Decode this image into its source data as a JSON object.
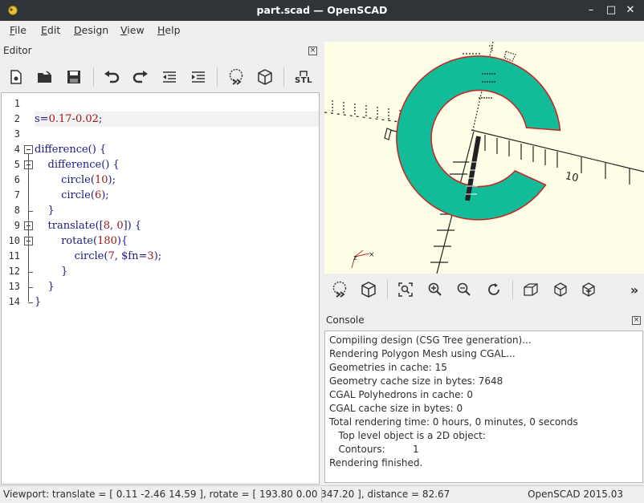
{
  "window": {
    "title": "part.scad — OpenSCAD",
    "minimize": "–",
    "maximize": "□",
    "close": "✕"
  },
  "menubar": {
    "items": [
      {
        "label": "File"
      },
      {
        "label": "Edit"
      },
      {
        "label": "Design"
      },
      {
        "label": "View"
      },
      {
        "label": "Help"
      }
    ]
  },
  "editor": {
    "title": "Editor",
    "toolbar": [
      {
        "icon": "new-file-icon"
      },
      {
        "icon": "open-file-icon"
      },
      {
        "icon": "save-icon"
      },
      {
        "icon": "undo-icon"
      },
      {
        "icon": "redo-icon"
      },
      {
        "icon": "unindent-icon"
      },
      {
        "icon": "indent-icon"
      },
      {
        "icon": "preview-icon"
      },
      {
        "icon": "render-icon"
      },
      {
        "icon": "export-stl-icon",
        "label": "STL"
      }
    ],
    "lines": [
      {
        "num": "1",
        "text": ""
      },
      {
        "num": "2",
        "text": "s=0.17-0.02;"
      },
      {
        "num": "3",
        "text": ""
      },
      {
        "num": "4",
        "text": "difference() {"
      },
      {
        "num": "5",
        "text": "    difference() {"
      },
      {
        "num": "6",
        "text": "        circle(10);"
      },
      {
        "num": "7",
        "text": "        circle(6);"
      },
      {
        "num": "8",
        "text": "    }"
      },
      {
        "num": "9",
        "text": "    translate([8, 0]) {"
      },
      {
        "num": "10",
        "text": "        rotate(180){"
      },
      {
        "num": "11",
        "text": "            circle(7, $fn=3);"
      },
      {
        "num": "12",
        "text": "        }"
      },
      {
        "num": "13",
        "text": "    }"
      },
      {
        "num": "14",
        "text": "}"
      }
    ]
  },
  "viewport": {
    "axis_label_10": "10",
    "axis_label_z": "z",
    "shape_color": "#12bc99",
    "outline_color": "#cc2020",
    "background_color": "#fffee6"
  },
  "view_toolbar": [
    {
      "icon": "preview-icon"
    },
    {
      "icon": "render-icon"
    },
    {
      "icon": "view-all-icon"
    },
    {
      "icon": "zoom-in-icon"
    },
    {
      "icon": "zoom-out-icon"
    },
    {
      "icon": "reset-view-icon"
    },
    {
      "icon": "view-perspective-icon"
    },
    {
      "icon": "view-orthogonal-icon"
    },
    {
      "icon": "view-axes-icon"
    },
    {
      "icon": "more-icon",
      "label": "»"
    }
  ],
  "console": {
    "title": "Console",
    "lines": [
      "Compiling design (CSG Tree generation)...",
      "Rendering Polygon Mesh using CGAL...",
      "Geometries in cache: 15",
      "Geometry cache size in bytes: 7648",
      "CGAL Polyhedrons in cache: 0",
      "CGAL cache size in bytes: 0",
      "Total rendering time: 0 hours, 0 minutes, 0 seconds",
      "   Top level object is a 2D object:",
      "   Contours:         1",
      "Rendering finished."
    ]
  },
  "statusbar": {
    "viewport_info": "Viewport: translate = [ 0.11 -2.46 14.59 ], rotate = [ 193.80 0.00 347.20 ], distance = 82.67",
    "version": "OpenSCAD 2015.03"
  }
}
